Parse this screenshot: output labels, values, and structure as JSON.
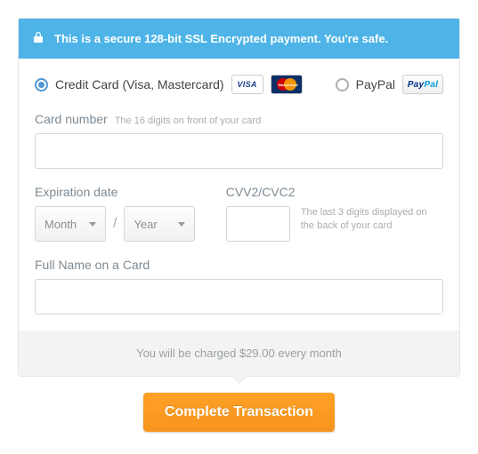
{
  "banner": {
    "text": "This is a secure 128-bit SSL Encrypted payment. You're safe."
  },
  "methods": {
    "credit": {
      "label": "Credit Card (Visa, Mastercard)",
      "visa_badge": "VISA",
      "mc_badge": "MasterCard"
    },
    "paypal": {
      "label": "PayPal",
      "badge_p1": "Pay",
      "badge_p2": "Pal"
    }
  },
  "card_number": {
    "label": "Card number",
    "hint": "The 16 digits on front of your card",
    "value": ""
  },
  "expiration": {
    "label": "Expiration date",
    "month_placeholder": "Month",
    "year_placeholder": "Year",
    "separator": "/"
  },
  "cvv": {
    "label": "CVV2/CVC2",
    "hint": "The last 3 digits displayed on the back of your card",
    "value": ""
  },
  "full_name": {
    "label": "Full Name on a Card",
    "value": ""
  },
  "footer": {
    "text": "You will be charged $29.00 every month"
  },
  "cta": {
    "label": "Complete Transaction"
  }
}
